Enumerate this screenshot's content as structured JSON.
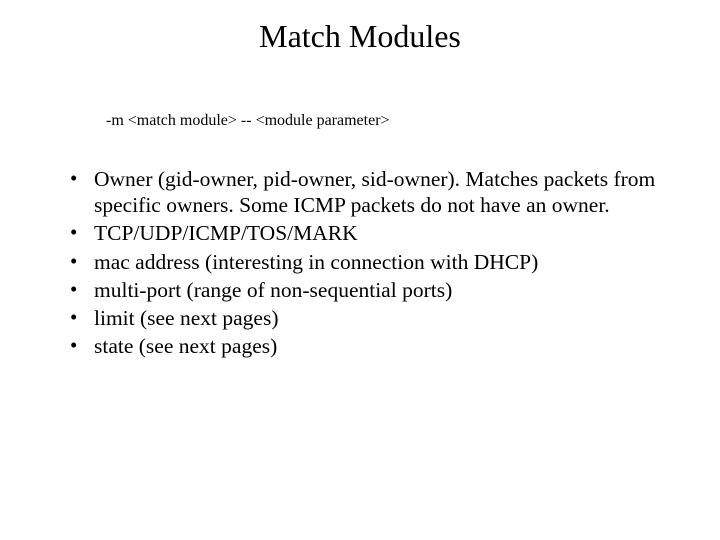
{
  "title": "Match Modules",
  "syntax": "-m <match module>  -- <module parameter>",
  "bullets": [
    "Owner (gid-owner, pid-owner, sid-owner). Matches packets from specific owners. Some ICMP packets do not have an owner.",
    "TCP/UDP/ICMP/TOS/MARK",
    "mac address (interesting in connection with DHCP)",
    "multi-port (range of non-sequential ports)",
    "limit (see next pages)",
    "state (see next pages)"
  ]
}
